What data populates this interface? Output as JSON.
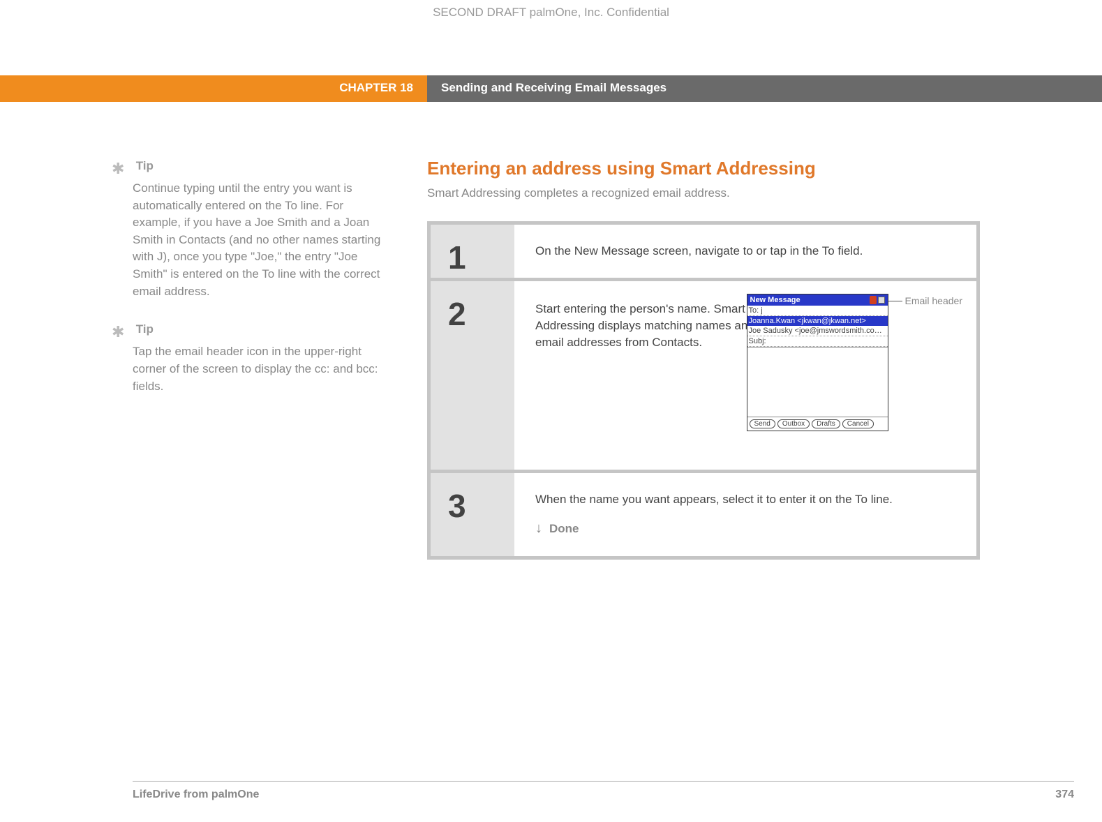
{
  "confidential": "SECOND DRAFT palmOne, Inc.  Confidential",
  "chapter": "CHAPTER 18",
  "header_title": "Sending and Receiving Email Messages",
  "tips": [
    {
      "label": "Tip",
      "text": "Continue typing until the entry you want is automatically entered on the To line. For example, if you have a Joe Smith and a Joan Smith in Contacts (and no other names starting with J), once you type \"Joe,\" the entry \"Joe Smith\" is entered on the To line with the correct email address."
    },
    {
      "label": "Tip",
      "text": "Tap the email header icon in the upper-right corner of the screen to display the cc: and bcc: fields."
    }
  ],
  "section": {
    "title": "Entering an address using Smart Addressing",
    "subtitle": "Smart Addressing completes a recognized email address."
  },
  "steps": [
    {
      "num": "1",
      "text": "On the New Message screen, navigate to or tap in the To field."
    },
    {
      "num": "2",
      "text": "Start entering the person's name. Smart Addressing displays matching names and email addresses from Contacts."
    },
    {
      "num": "3",
      "text": "When the name you want appears, select it to enter it on the To line."
    }
  ],
  "done": "Done",
  "palm": {
    "title": "New Message",
    "to_label": "To:",
    "to_value": "j",
    "match1": "Joanna.Kwan <jkwan@jkwan.net>",
    "match2": "Joe Sadusky <joe@jmswordsmith.co…",
    "subj_label": "Subj:",
    "buttons": [
      "Send",
      "Outbox",
      "Drafts",
      "Cancel"
    ]
  },
  "callout": "Email header",
  "footer": {
    "left": "LifeDrive from palmOne",
    "right": "374"
  }
}
